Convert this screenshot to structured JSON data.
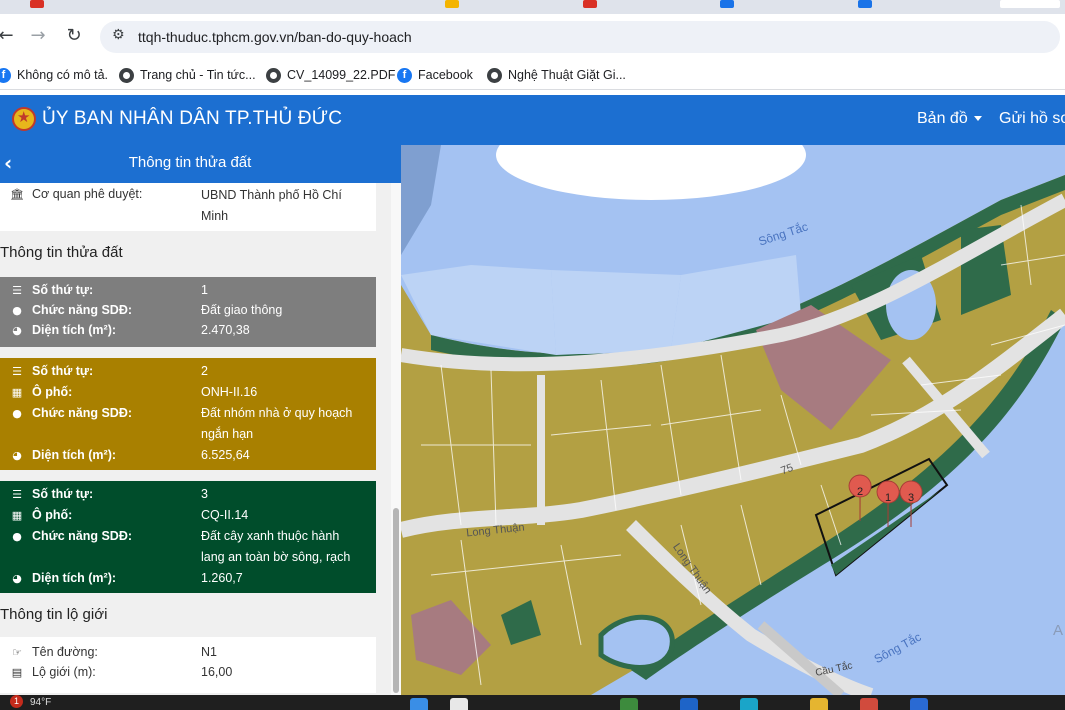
{
  "browser": {
    "url": "ttqh-thuduc.tphcm.gov.vn/ban-do-quy-hoach",
    "bookmarks": [
      {
        "label": "Không có mô tả.",
        "icon": "facebook-icon"
      },
      {
        "label": "Trang chủ - Tin tức...",
        "icon": "globe-icon"
      },
      {
        "label": "CV_14099_22.PDF",
        "icon": "globe-icon"
      },
      {
        "label": "Facebook",
        "icon": "facebook-icon"
      },
      {
        "label": "Nghệ Thuật Giặt Gi...",
        "icon": "globe-icon"
      }
    ]
  },
  "header": {
    "title": "ỦY BAN NHÂN DÂN TP.THỦ ĐỨC",
    "menu": [
      "Bản đồ",
      "Gửi hồ sơ"
    ]
  },
  "panel": {
    "title": "Thông tin thửa đất",
    "approval": {
      "label": "Cơ quan phê duyệt:",
      "value": "UBND Thành phố Hồ Chí Minh"
    },
    "parcel_section_title": "Thông tin thửa đất",
    "parcels": [
      {
        "color": "#7e7e7e",
        "rows": [
          {
            "label": "Số thứ tự:",
            "value": "1"
          },
          {
            "label": "Chức năng SDĐ:",
            "value": "Đất giao thông"
          },
          {
            "label": "Diện tích (m²):",
            "value": "2.470,38"
          }
        ]
      },
      {
        "color": "#a98000",
        "rows": [
          {
            "label": "Số thứ tự:",
            "value": "2"
          },
          {
            "label": "Ô phố:",
            "value": "ONH-II.16"
          },
          {
            "label": "Chức năng SDĐ:",
            "value": "Đất nhóm nhà ở quy hoạch ngắn hạn"
          },
          {
            "label": "Diện tích (m²):",
            "value": "6.525,64"
          }
        ]
      },
      {
        "color": "#004d2b",
        "rows": [
          {
            "label": "Số thứ tự:",
            "value": "3"
          },
          {
            "label": "Ô phố:",
            "value": "CQ-II.14"
          },
          {
            "label": "Chức năng SDĐ:",
            "value": "Đất cây xanh thuộc hành lang an toàn bờ sông, rạch"
          },
          {
            "label": "Diện tích (m²):",
            "value": "1.260,7"
          }
        ]
      }
    ],
    "boundary_section_title": "Thông tin lộ giới",
    "boundary": [
      {
        "label": "Tên đường:",
        "value": "N1"
      },
      {
        "label": "Lộ giới (m):",
        "value": "16,00"
      }
    ]
  },
  "map": {
    "labels": {
      "river_top": "Sông Tắc",
      "river_bottom": "Sông Tắc",
      "road_a": "Long Thuận",
      "road_b": "Long Thuận",
      "road_num": "75",
      "bridge": "Cầu Tắc",
      "edge_letter": "A"
    },
    "markers": [
      "2",
      "1",
      "3"
    ],
    "colors": {
      "water": "#a4c2f2",
      "residential": "#b3a043",
      "green": "#2f6b4a",
      "road": "#e3e3e3",
      "public": "#a77b80"
    }
  },
  "taskbar": {
    "badge": "1",
    "temperature": "94°F"
  }
}
